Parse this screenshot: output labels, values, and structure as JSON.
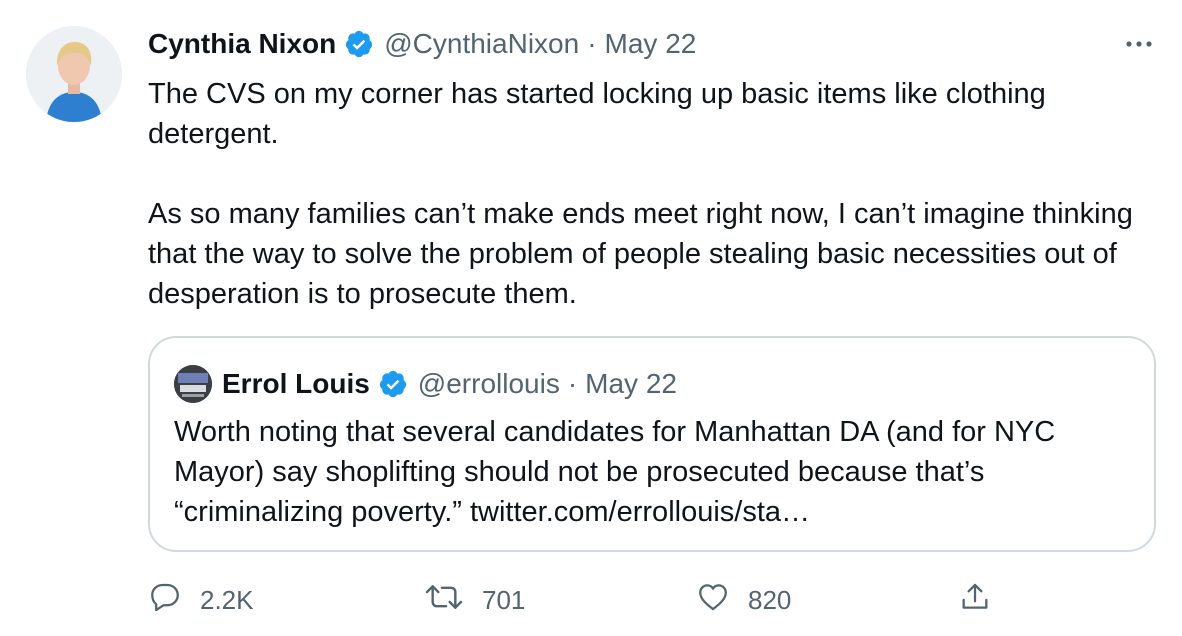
{
  "tweet": {
    "author_name": "Cynthia Nixon",
    "author_handle": "@CynthiaNixon",
    "separator": "·",
    "date": "May 22",
    "text": "The CVS on my corner has started locking up basic items like clothing detergent.\n\nAs so many families can’t make ends meet right now, I can’t imagine thinking that the way to solve the problem of people stealing basic necessities out of desperation is to prosecute them."
  },
  "quoted_tweet": {
    "author_name": "Errol Louis",
    "author_handle": "@errollouis",
    "separator": "·",
    "date": "May 22",
    "text": "Worth noting that several candidates for Manhattan DA (and for NYC Mayor) say shoplifting should not be prosecuted because that’s “criminalizing poverty.” twitter.com/errollouis/sta…"
  },
  "actions": {
    "reply_count": "2.2K",
    "retweet_count": "701",
    "like_count": "820"
  },
  "icons": {
    "verified": "verified-badge-icon",
    "more": "more-options-icon",
    "reply": "reply-icon",
    "retweet": "retweet-icon",
    "like": "heart-icon",
    "share": "share-icon"
  },
  "colors": {
    "verified_blue": "#1d9bf0",
    "secondary_text": "#536471",
    "border": "#cfd9de"
  }
}
